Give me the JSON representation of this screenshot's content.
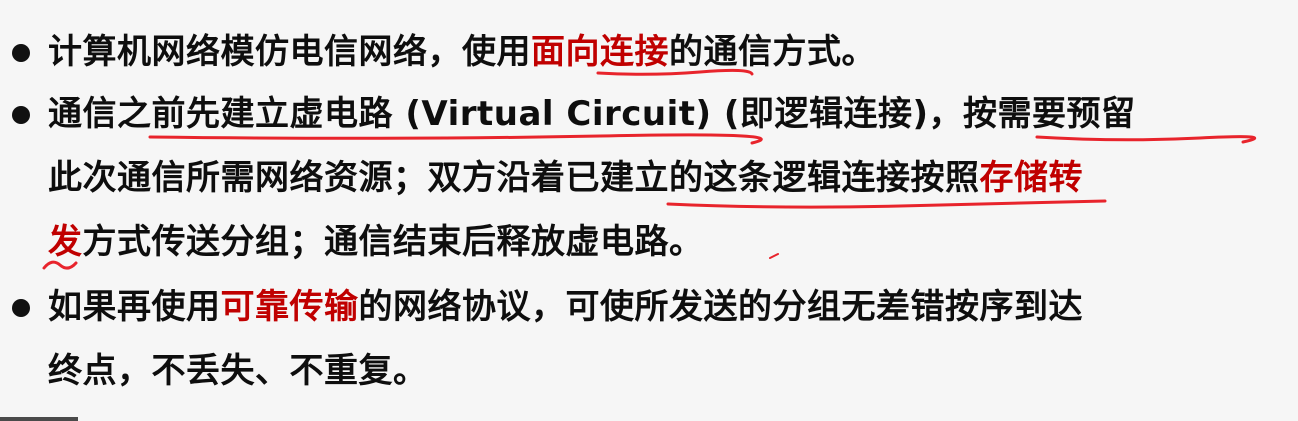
{
  "bullets": [
    {
      "lines": [
        {
          "segments": [
            {
              "text": "计算机网络模仿电信网络，使用",
              "red": false
            },
            {
              "text": "面向连接",
              "red": true
            },
            {
              "text": "的通信方式。",
              "red": false
            }
          ]
        }
      ]
    },
    {
      "lines": [
        {
          "segments": [
            {
              "text": "通信之前先建立虚电路 (Virtual Circuit) (即逻辑连接)，按需要预留",
              "red": false
            }
          ]
        },
        {
          "segments": [
            {
              "text": "此次通信所需网络资源；双方沿着已建立的这条逻辑连接按照",
              "red": false
            },
            {
              "text": "存储转",
              "red": true
            }
          ]
        },
        {
          "segments": [
            {
              "text": "发",
              "red": true
            },
            {
              "text": "方式传送分组；通信结束后释放虚电路。",
              "red": false
            }
          ]
        }
      ]
    },
    {
      "lines": [
        {
          "segments": [
            {
              "text": "如果再使用",
              "red": false
            },
            {
              "text": "可靠传输",
              "red": true
            },
            {
              "text": "的网络协议，可使所发送的分组无差错按序到达",
              "red": false
            }
          ]
        },
        {
          "segments": [
            {
              "text": "终点，不丢失、不重复。",
              "red": false
            }
          ]
        }
      ]
    }
  ],
  "colors": {
    "text": "#0e0e0e",
    "highlight": "#c00000",
    "annotation": "#e8242c",
    "background": "#f6f6f6"
  }
}
